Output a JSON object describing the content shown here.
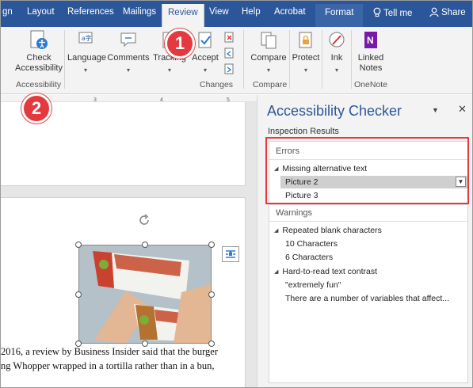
{
  "tabs": [
    {
      "label": "gn"
    },
    {
      "label": "Layout"
    },
    {
      "label": "References"
    },
    {
      "label": "Mailings"
    },
    {
      "label": "Review"
    },
    {
      "label": "View"
    },
    {
      "label": "Help"
    },
    {
      "label": "Acrobat"
    },
    {
      "label": "Format"
    },
    {
      "label": "Tell me"
    },
    {
      "label": "Share"
    }
  ],
  "ribbon": {
    "check_accessibility": "Check Accessibility",
    "accessibility_group": "Accessibility",
    "language": "Language",
    "comments": "Comments",
    "tracking": "Tracking",
    "accept": "Accept",
    "changes_group": "Changes",
    "compare": "Compare",
    "compare_group": "Compare",
    "protect": "Protect",
    "ink": "Ink",
    "linked_notes": "Linked Notes",
    "onenote_group": "OneNote"
  },
  "ruler": {
    "ticks": [
      "3",
      "4",
      "5"
    ]
  },
  "document": {
    "line1": "2016, a review by Business Insider said that the burger",
    "line2": "ng Whopper wrapped in a tortilla rather than in a bun,"
  },
  "pane": {
    "title": "Accessibility Checker",
    "menu_glyph": "▼",
    "close_glyph": "✕",
    "inspection_results": "Inspection Results",
    "errors_label": "Errors",
    "errors": {
      "category": "Missing alternative text",
      "items": [
        "Picture 2",
        "Picture 3"
      ]
    },
    "warnings_label": "Warnings",
    "warnings": [
      {
        "category": "Repeated blank characters",
        "items": [
          "10 Characters",
          "6 Characters"
        ]
      },
      {
        "category": "Hard-to-read text contrast",
        "items": [
          "\"extremely fun\"",
          "There are a number of variables that affect..."
        ]
      }
    ]
  },
  "badges": [
    "1",
    "2"
  ],
  "colors": {
    "accent": "#2b579a",
    "badge": "#e4393e"
  }
}
